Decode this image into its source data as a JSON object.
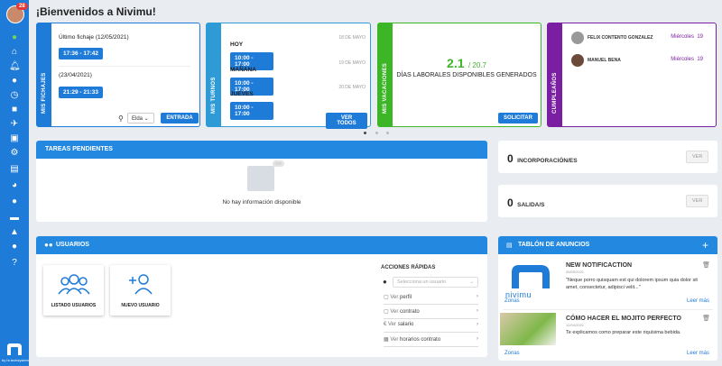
{
  "sidebar": {
    "badge": "28",
    "logo_text": "by hr.techsystem",
    "icons": [
      "leaf-icon",
      "home-icon",
      "bell-icon",
      "users-icon",
      "clock-icon",
      "briefcase-icon",
      "plane-icon",
      "id-card-icon",
      "gear-icon",
      "clipboard-icon",
      "pie-chart-icon",
      "chat-icon",
      "folder-icon",
      "graduation-icon",
      "user-settings-icon",
      "help-icon"
    ]
  },
  "page": {
    "title": "¡Bienvenidos a Nivimu!"
  },
  "fichajes": {
    "strip": "MIS FICHAJES",
    "last_label": "Último fichaje (12/05/2021)",
    "last_time": "17:36 - 17:42",
    "prev_label": "(23/04/2021)",
    "prev_time": "21:29 - 21:33",
    "location": "Elda",
    "enter": "ENTRADA"
  },
  "turnos": {
    "strip": "MIS TURNOS",
    "rows": [
      {
        "day": "HOY",
        "date": "18 DE MAYO",
        "time": "10:00 - 17:00"
      },
      {
        "day": "MAÑANA",
        "date": "19 DE MAYO",
        "time": "10:00 - 17:00"
      },
      {
        "day": "JUEVES",
        "date": "20 DE MAYO",
        "time": "10:00 - 17:00"
      }
    ],
    "see_all": "VER TODOS"
  },
  "vacaciones": {
    "strip": "MIS VACACIONES",
    "days": "2.1",
    "total": "/ 20.7",
    "label": "DÍAS LABORALES DISPONIBLES GENERADOS",
    "request": "SOLICITAR"
  },
  "cumple": {
    "strip": "CUMPLEAÑOS",
    "people": [
      {
        "name": "FELIX CONTENTO GONZALEZ",
        "day": "Miércoles",
        "num": "19"
      },
      {
        "name": "MANUEL BENA",
        "day": "Miércoles",
        "num": "19"
      }
    ]
  },
  "tareas": {
    "header": "TAREAS PENDIENTES",
    "badge": "???",
    "empty": "No hay información disponible"
  },
  "incorp": {
    "count": "0",
    "label": "INCORPORACIÓN/ES",
    "see": "VER"
  },
  "salida": {
    "count": "0",
    "label": "SALIDA/S",
    "see": "VER"
  },
  "usuarios": {
    "header": "USUARIOS",
    "tile1": "LISTADO USUARIOS",
    "tile2": "NUEVO USUARIO",
    "actions_title": "ACCIONES RÁPIDAS",
    "select_placeholder": "Selecciona un usuario",
    "actions": [
      {
        "pre": "Ver",
        "label": "perfil"
      },
      {
        "pre": "Ver",
        "label": "contrato"
      },
      {
        "pre": "Ver",
        "label": "salario"
      },
      {
        "pre": "Ver",
        "label": "horarios contrato"
      }
    ]
  },
  "tablon": {
    "header": "TABLÓN DE ANUNCIOS",
    "logo_text": "nivimu",
    "items": [
      {
        "title": "NEW NOTIFICACTION",
        "date": "05/05/2021",
        "body": "\"Neque porro quisquam est qui dolorem ipsum quia dolor sit amet, consectetur, adipisci velit...\"",
        "zones": "Zonas",
        "more": "Leer más"
      },
      {
        "title": "CÓMO HACER EL MOJITO PERFECTO",
        "date": "12/04/2021",
        "body": "Te explicamos como preparar este riquísima bebida.",
        "zones": "Zonas",
        "more": "Leer más"
      }
    ]
  },
  "colors": {
    "primary": "#1f7bd8",
    "fichajes": "#1f7bd8",
    "turnos": "#2e9bd6",
    "vacaciones": "#3cb527",
    "cumple": "#7b1fa2",
    "green": "#3cb527"
  }
}
